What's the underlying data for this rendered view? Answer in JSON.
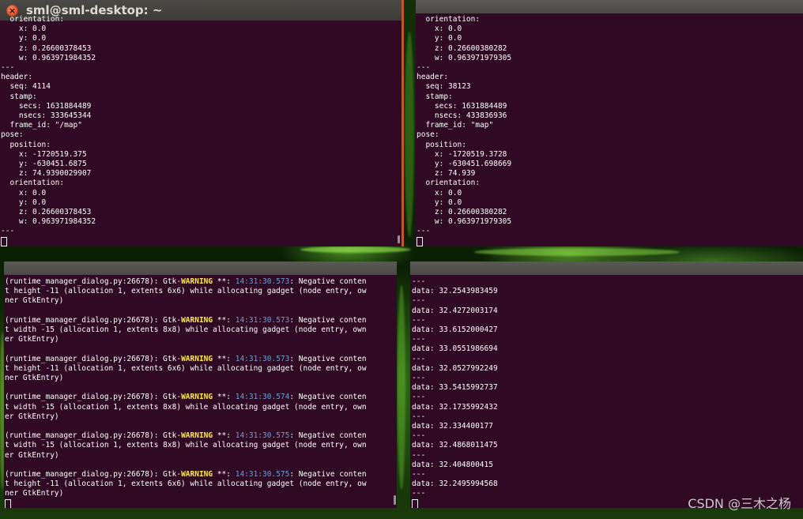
{
  "desktop": {
    "watermark": "CSDN @三木之杨"
  },
  "win_top_left": {
    "title": "sml@sml-desktop: ~",
    "lines": [
      "  orientation:",
      "    x: 0.0",
      "    y: 0.0",
      "    z: 0.26600378453",
      "    w: 0.963971984352",
      "---",
      "header:",
      "  seq: 4114",
      "  stamp:",
      "    secs: 1631884489",
      "    nsecs: 333645344",
      "  frame_id: \"/map\"",
      "pose:",
      "  position:",
      "    x: -1720519.375",
      "    y: -630451.6875",
      "    z: 74.9390029907",
      "  orientation:",
      "    x: 0.0",
      "    y: 0.0",
      "    z: 0.26600378453",
      "    w: 0.963971984352",
      "---"
    ]
  },
  "win_top_right": {
    "lines": [
      "  orientation:",
      "    x: 0.0",
      "    y: 0.0",
      "    z: 0.26600380282",
      "    w: 0.963971979305",
      "---",
      "header:",
      "  seq: 38123",
      "  stamp:",
      "    secs: 1631884489",
      "    nsecs: 433836936",
      "  frame_id: \"map\"",
      "pose:",
      "  position:",
      "    x: -1720519.3728",
      "    y: -630451.698669",
      "    z: 74.939",
      "  orientation:",
      "    x: 0.0",
      "    y: 0.0",
      "    z: 0.26600380282",
      "    w: 0.963971979305",
      "---"
    ]
  },
  "win_bottom_left": {
    "warnings": [
      {
        "prefix": "(runtime_manager_dialog.py:26678): Gtk-",
        "keyword": "WARNING",
        "mid": " **: ",
        "time": "14:31:30.573",
        "suffix": ": Negative conten",
        "line2": "t height -11 (allocation 1, extents 6x6) while allocating gadget (node entry, ow",
        "line3": "ner GtkEntry)"
      },
      {
        "prefix": "(runtime_manager_dialog.py:26678): Gtk-",
        "keyword": "WARNING",
        "mid": " **: ",
        "time": "14:31:30.573",
        "suffix": ": Negative conten",
        "line2": "t width -15 (allocation 1, extents 8x8) while allocating gadget (node entry, own",
        "line3": "er GtkEntry)"
      },
      {
        "prefix": "(runtime_manager_dialog.py:26678): Gtk-",
        "keyword": "WARNING",
        "mid": " **: ",
        "time": "14:31:30.573",
        "suffix": ": Negative conten",
        "line2": "t height -11 (allocation 1, extents 6x6) while allocating gadget (node entry, ow",
        "line3": "ner GtkEntry)"
      },
      {
        "prefix": "(runtime_manager_dialog.py:26678): Gtk-",
        "keyword": "WARNING",
        "mid": " **: ",
        "time": "14:31:30.574",
        "suffix": ": Negative conten",
        "line2": "t width -15 (allocation 1, extents 8x8) while allocating gadget (node entry, own",
        "line3": "er GtkEntry)"
      },
      {
        "prefix": "(runtime_manager_dialog.py:26678): Gtk-",
        "keyword": "WARNING",
        "mid": " **: ",
        "time": "14:31:30.575",
        "suffix": ": Negative conten",
        "line2": "t width -15 (allocation 1, extents 8x8) while allocating gadget (node entry, own",
        "line3": "er GtkEntry)"
      },
      {
        "prefix": "(runtime_manager_dialog.py:26678): Gtk-",
        "keyword": "WARNING",
        "mid": " **: ",
        "time": "14:31:30.575",
        "suffix": ": Negative conten",
        "line2": "t height -11 (allocation 1, extents 6x6) while allocating gadget (node entry, ow",
        "line3": "ner GtkEntry)"
      }
    ]
  },
  "win_bottom_right": {
    "lines": [
      "---",
      "data: 32.2543983459",
      "---",
      "data: 32.4272003174",
      "---",
      "data: 33.6152000427",
      "---",
      "data: 33.0551986694",
      "---",
      "data: 32.0527992249",
      "---",
      "data: 33.5415992737",
      "---",
      "data: 32.1735992432",
      "---",
      "data: 32.334400177",
      "---",
      "data: 32.4868011475",
      "---",
      "data: 32.404800415",
      "---",
      "data: 32.2495994568",
      "---"
    ]
  }
}
